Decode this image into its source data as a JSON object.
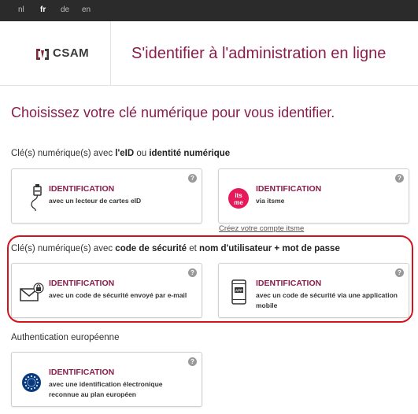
{
  "languages": [
    {
      "code": "nl",
      "active": false
    },
    {
      "code": "fr",
      "active": true
    },
    {
      "code": "de",
      "active": false
    },
    {
      "code": "en",
      "active": false
    }
  ],
  "brand": {
    "name": "CSAM"
  },
  "header": {
    "title": "S'identifier à l'administration en ligne"
  },
  "main_title": "Choisissez votre clé numérique pour vous identifier.",
  "sections": {
    "eid": {
      "prefix": "Clé(s) numérique(s) avec ",
      "bold1": "l'eID",
      "middle": " ou ",
      "bold2": "identité numérique"
    },
    "security": {
      "prefix": "Clé(s) numérique(s) avec ",
      "bold1": "code de sécurité",
      "middle": " et ",
      "bold2": "nom d'utilisateur + mot de passe"
    },
    "european": {
      "label": "Authentication européenne"
    }
  },
  "cards": {
    "eid_reader": {
      "title": "IDENTIFICATION",
      "desc": "avec un lecteur de cartes eID",
      "icon": "card-reader-icon"
    },
    "itsme": {
      "title": "IDENTIFICATION",
      "desc": "via itsme",
      "icon": "itsme-logo",
      "logo_text": "its me"
    },
    "email_code": {
      "title": "IDENTIFICATION",
      "desc": "avec un code de sécurité envoyé par e-mail",
      "icon": "email-lock-icon"
    },
    "app_code": {
      "title": "IDENTIFICATION",
      "desc": "avec un code de sécurité via une application mobile",
      "icon": "mobile-app-icon",
      "app_badge": "APP"
    },
    "european": {
      "title": "IDENTIFICATION",
      "desc": "avec une identification électronique reconnue au plan européen",
      "icon": "eu-stars-icon"
    }
  },
  "help_symbol": "?",
  "itsme_link": "Créez votre compte itsme",
  "colors": {
    "accent": "#8a1d4a",
    "highlight": "#d2141f",
    "itsme": "#e6195a",
    "topbar": "#2b2b2b"
  }
}
